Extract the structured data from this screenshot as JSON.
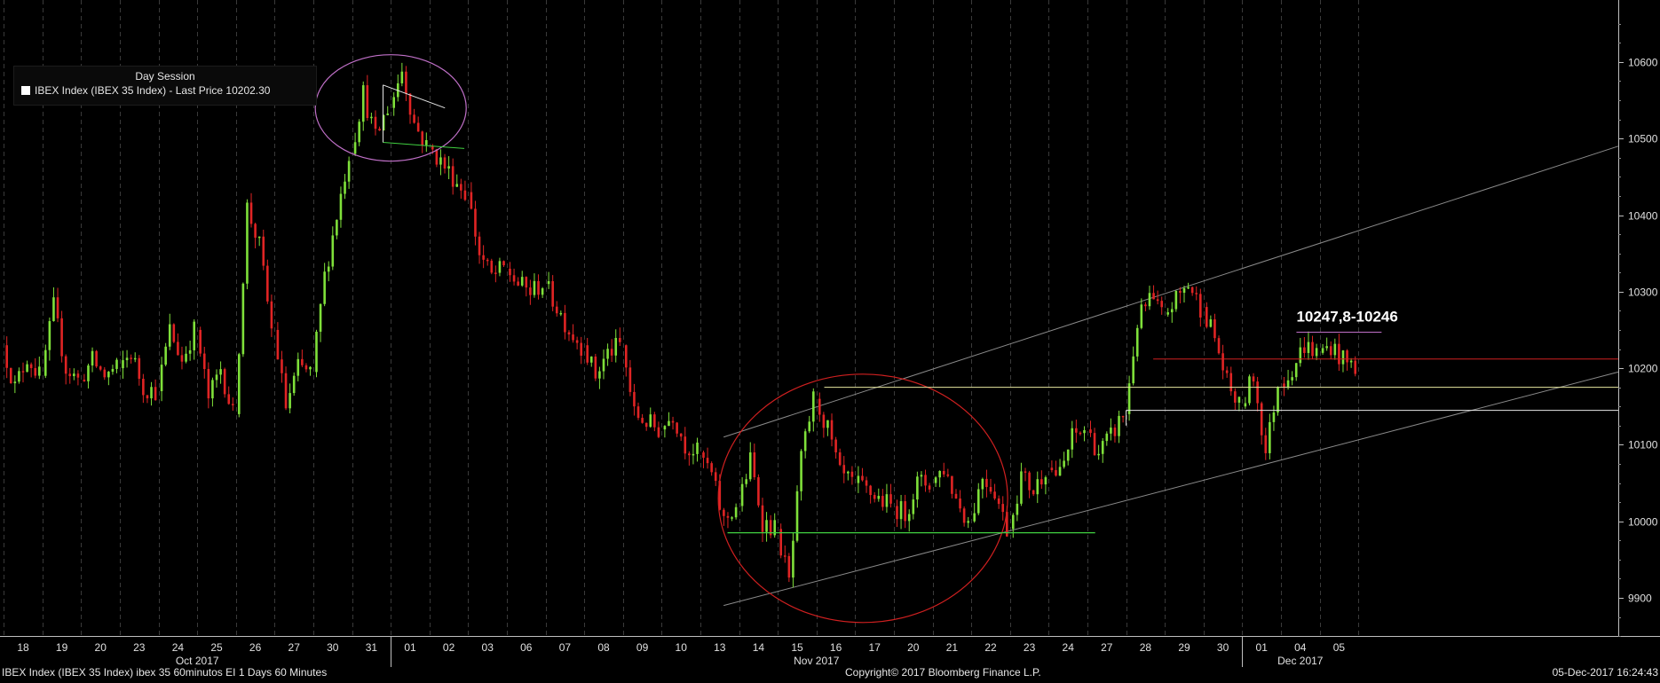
{
  "legend": {
    "session": "Day Session",
    "series_label": "IBEX Index (IBEX 35 Index) - Last Price 10202.30"
  },
  "footer": {
    "left": "IBEX Index (IBEX 35 Index) ibex 35 60minutos EI 1 Days 60 Minutes",
    "center": "Copyright© 2017 Bloomberg Finance L.P.",
    "right": "05-Dec-2017 16:24:43"
  },
  "colors": {
    "background": "#000000",
    "up_candle": "#7fe03a",
    "down_candle": "#e02424",
    "annotation_purple": "#c070c8",
    "annotation_red": "#d02020",
    "annotation_green": "#40d040",
    "annotation_yellow": "#e8e8a0",
    "channel": "#8a8a8a"
  },
  "chart_data": {
    "type": "candlestick",
    "interval": "60 Minutes",
    "ylim": [
      9850,
      10660
    ],
    "yticks": [
      9900,
      10000,
      10100,
      10200,
      10300,
      10400,
      10500,
      10600
    ],
    "x_day_labels": [
      "18",
      "19",
      "20",
      "23",
      "24",
      "25",
      "26",
      "27",
      "30",
      "31",
      "01",
      "02",
      "03",
      "06",
      "07",
      "08",
      "09",
      "10",
      "13",
      "14",
      "15",
      "16",
      "17",
      "20",
      "21",
      "22",
      "23",
      "24",
      "27",
      "28",
      "29",
      "30",
      "01",
      "04",
      "05"
    ],
    "month_labels": [
      {
        "label": "Oct 2017",
        "start_index": 0
      },
      {
        "label": "Nov 2017",
        "start_index": 10
      },
      {
        "label": "Dec 2017",
        "start_index": 32
      }
    ],
    "annotation_text": "10247,8-10246",
    "daily_path": [
      [
        10230,
        10175,
        10215,
        10190
      ],
      [
        10190,
        10280,
        10200,
        10185
      ],
      [
        10185,
        10210,
        10190,
        10200
      ],
      [
        10200,
        10220,
        10175,
        10170
      ],
      [
        10170,
        10250,
        10210,
        10250
      ],
      [
        10250,
        10160,
        10200,
        10140
      ],
      [
        10140,
        10410,
        10360,
        10250
      ],
      [
        10250,
        10150,
        10200,
        10195
      ],
      [
        10195,
        10320,
        10400,
        10480
      ],
      [
        10480,
        10560,
        10500,
        10540
      ],
      [
        10540,
        10590,
        10520,
        10490
      ],
      [
        10490,
        10470,
        10450,
        10430
      ],
      [
        10430,
        10350,
        10320,
        10330
      ],
      [
        10330,
        10310,
        10300,
        10310
      ],
      [
        10310,
        10280,
        10250,
        10230
      ],
      [
        10230,
        10190,
        10220,
        10230
      ],
      [
        10230,
        10140,
        10130,
        10120
      ],
      [
        10120,
        10140,
        10100,
        10090
      ],
      [
        10090,
        10060,
        10000,
        10020
      ],
      [
        10020,
        10080,
        10000,
        9990
      ],
      [
        9990,
        9920,
        10080,
        10160
      ],
      [
        10160,
        10120,
        10060,
        10050
      ],
      [
        10050,
        10040,
        10030,
        10020
      ],
      [
        10020,
        10010,
        10050,
        10050
      ],
      [
        10050,
        10070,
        10030,
        10000
      ],
      [
        10000,
        10060,
        10040,
        9990
      ],
      [
        9990,
        10060,
        10040,
        10070
      ],
      [
        10070,
        10060,
        10110,
        10120
      ],
      [
        10120,
        10090,
        10110,
        10140
      ],
      [
        10140,
        10260,
        10290,
        10270
      ],
      [
        10270,
        10290,
        10310,
        10280
      ],
      [
        10280,
        10240,
        10180,
        10150
      ],
      [
        10150,
        10190,
        10090,
        10180
      ],
      [
        10180,
        10200,
        10230,
        10220
      ],
      [
        10220,
        10230,
        10210,
        10202
      ]
    ],
    "annotations": {
      "purple_circle": {
        "day_start": 8,
        "day_end": 11,
        "price_center": 10540
      },
      "red_circle": {
        "day_start": 18,
        "day_end": 26,
        "price_center": 10030
      },
      "support_green": {
        "day_start": 18,
        "day_end": 28,
        "price": 9985
      },
      "resistance_yellow": {
        "day_start": 20,
        "day_end": 35,
        "price": 10175
      },
      "resistance_white": {
        "day_start": 29,
        "day_end": 35,
        "price": 10145
      },
      "red_level": {
        "day_start": 29,
        "day_end": 35,
        "price": 10212
      },
      "purple_level": {
        "day_start": 33,
        "day_end": 34.2,
        "price": 10247
      },
      "channel_upper": [
        [
          20,
          10150
        ],
        [
          35,
          10490
        ]
      ],
      "channel_lower": [
        [
          20,
          9895
        ],
        [
          35,
          10225
        ]
      ],
      "triangle_top": [
        [
          9.3,
          10570
        ],
        [
          10.9,
          10540
        ]
      ],
      "triangle_bottom": [
        [
          9.3,
          10495
        ],
        [
          11.4,
          10487
        ]
      ]
    }
  }
}
